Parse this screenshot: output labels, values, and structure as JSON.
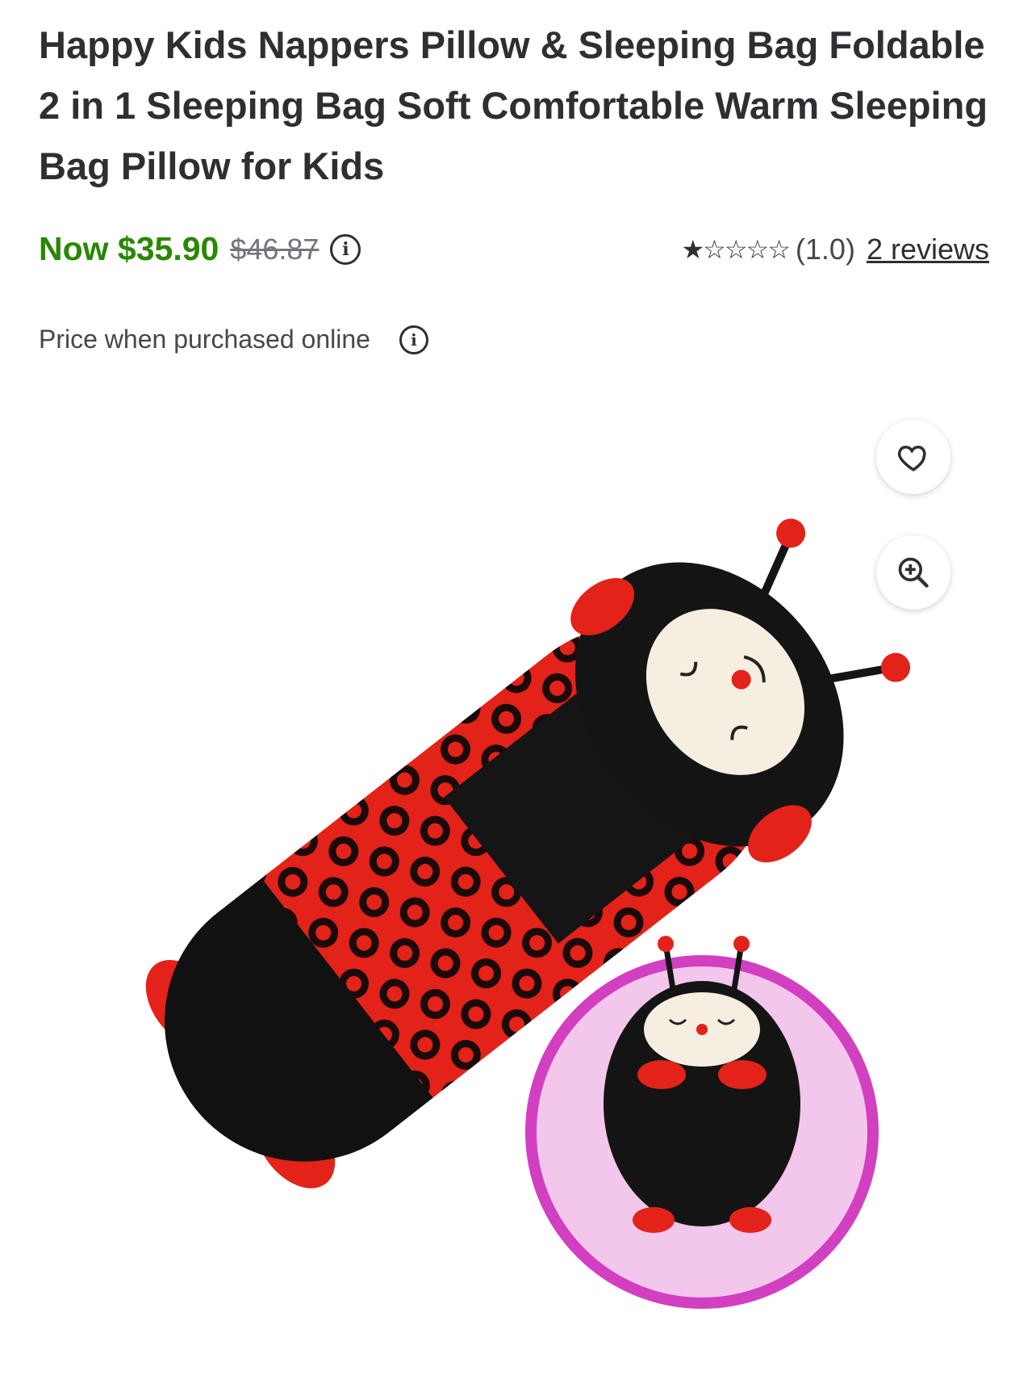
{
  "product": {
    "title": "Happy Kids Nappers Pillow & Sleeping Bag Foldable 2 in 1 Sleeping Bag Soft Comfortable Warm Sleeping Bag Pillow for Kids",
    "price_now": "Now $35.90",
    "price_was": "$46.87",
    "price_note": "Price when purchased online",
    "rating": {
      "stars": 1.0,
      "max": 5,
      "value_text": "(1.0)",
      "reviews_text": "2 reviews"
    },
    "image": {
      "alt": "ladybug sleeping bag"
    }
  },
  "icons": {
    "info": "info-icon",
    "favorite": "heart-icon",
    "zoom": "zoom-in-icon",
    "star_filled": "star-filled-icon",
    "star_empty": "star-empty-icon"
  },
  "colors": {
    "price": "#2a8703",
    "text": "#2e2f32",
    "muted": "#74767c"
  }
}
